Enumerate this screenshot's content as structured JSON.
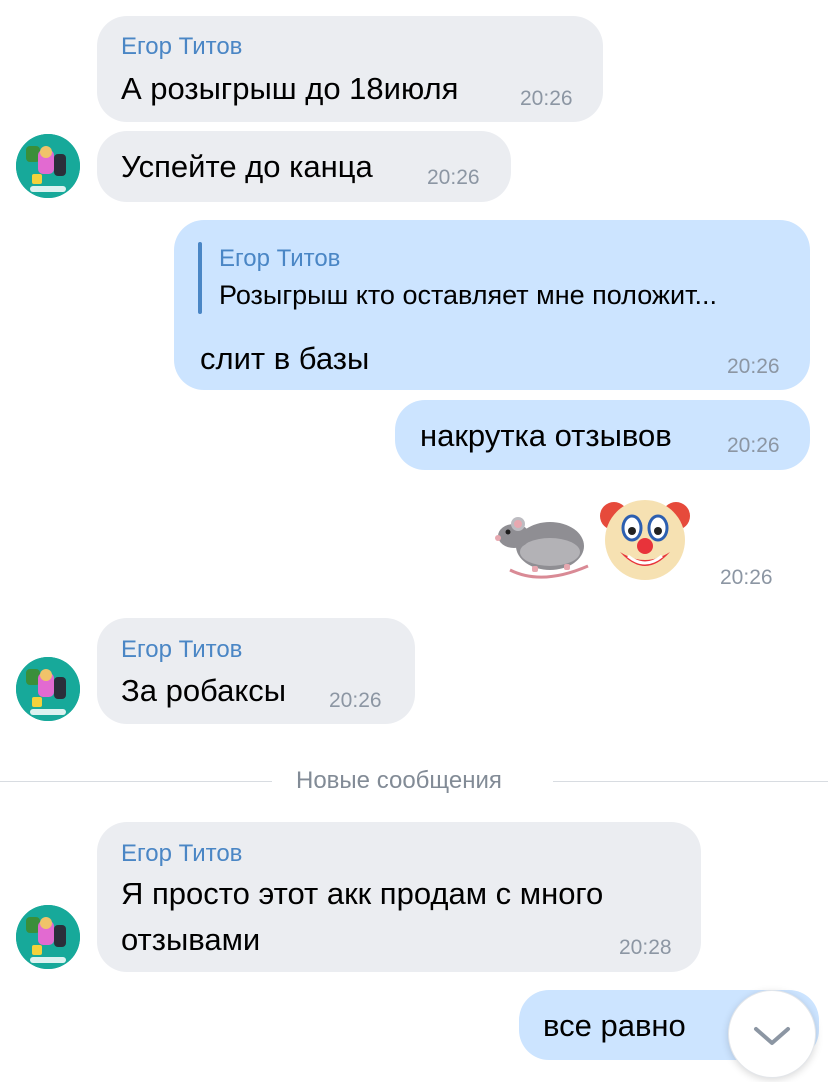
{
  "messages": [
    {
      "sender": "Егор Титов",
      "text": "А розыгрыш до 18июля",
      "time": "20:26"
    },
    {
      "text": "Успейте до канца",
      "time": "20:26"
    },
    {
      "quote_sender": "Егор Титов",
      "quote_text": "Розыгрыш кто оставляет мне положит...",
      "text": "слит в базы",
      "time": "20:26"
    },
    {
      "text": "накрутка отзывов",
      "time": "20:26"
    },
    {
      "emoji": "🐀🤡",
      "time": "20:26"
    },
    {
      "sender": "Егор Титов",
      "text": "За робаксы",
      "time": "20:26"
    },
    {
      "sender": "Егор Титов",
      "text_line1": "Я просто этот акк продам с много",
      "text_line2": "отзывами",
      "time": "20:28"
    },
    {
      "text": "все равно"
    }
  ],
  "divider": {
    "label": "Новые сообщения"
  },
  "avatar_watermark": "Егор Титов",
  "icons": {
    "scroll_down": "chevron-down-icon"
  },
  "colors": {
    "incoming": "#ebedf1",
    "outgoing": "#cce4ff",
    "sender": "#4a86c5",
    "time": "#8c96a3"
  }
}
